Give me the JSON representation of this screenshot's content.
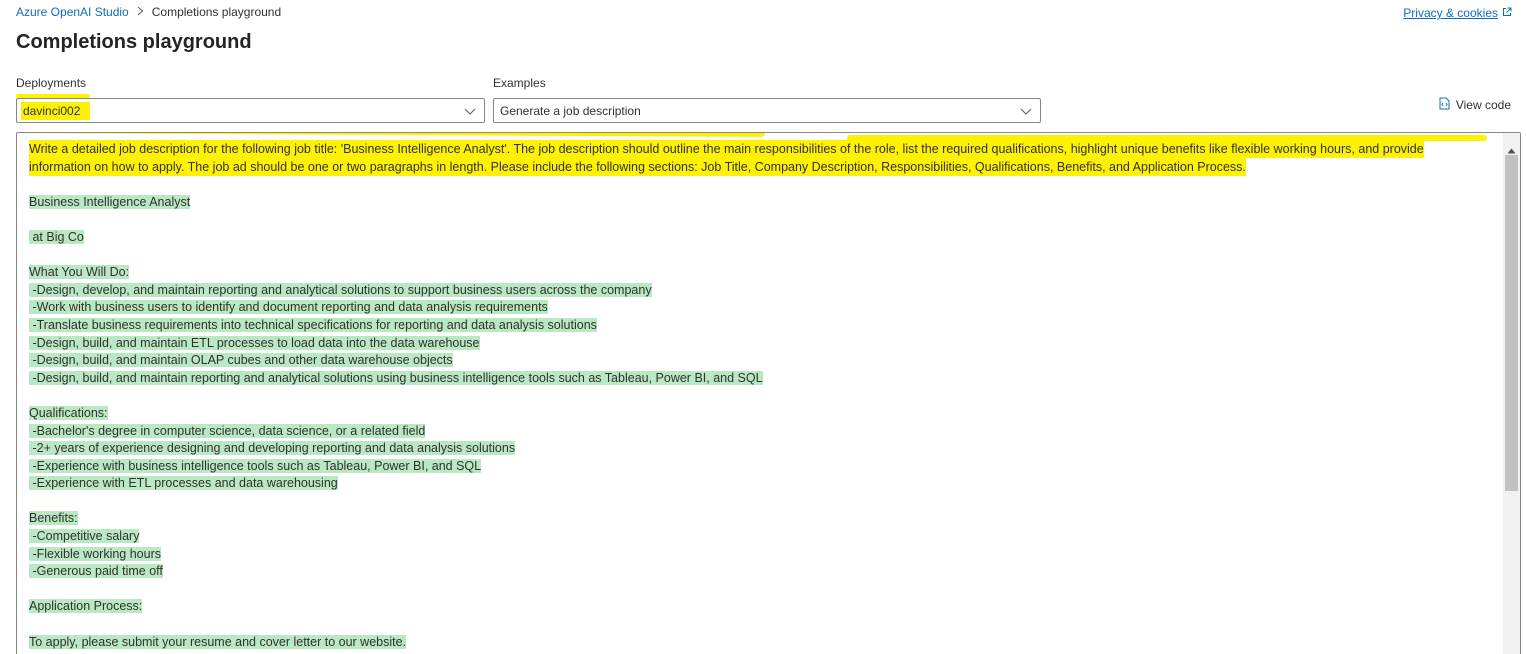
{
  "breadcrumb": {
    "root": "Azure OpenAI Studio",
    "current": "Completions playground"
  },
  "privacy_link": "Privacy & cookies",
  "page_title": "Completions playground",
  "deployments": {
    "label": "Deployments",
    "value": "davinci002"
  },
  "examples": {
    "label": "Examples",
    "value": "Generate a job description"
  },
  "view_code": "View code",
  "prompt": {
    "line1": "Write a detailed job description for the following job title: 'Business Intelligence Analyst'. The job description should outline the main responsibilities of the role, list the required qualifications, highlight unique benefits like flexible working hours, and provide",
    "line2": "information on how to apply. The job ad should be one or two paragraphs in length. Please include the following sections: Job Title, Company Description, Responsibilities, Qualifications, Benefits, and Application Process."
  },
  "response_lines": [
    "",
    "Business Intelligence Analyst",
    "",
    " at Big Co",
    "",
    "What You Will Do:",
    " -Design, develop, and maintain reporting and analytical solutions to support business users across the company",
    " -Work with business users to identify and document reporting and data analysis requirements",
    " -Translate business requirements into technical specifications for reporting and data analysis solutions",
    " -Design, build, and maintain ETL processes to load data into the data warehouse",
    " -Design, build, and maintain OLAP cubes and other data warehouse objects",
    " -Design, build, and maintain reporting and analytical solutions using business intelligence tools such as Tableau, Power BI, and SQL",
    "",
    "Qualifications:",
    " -Bachelor's degree in computer science, data science, or a related field",
    " -2+ years of experience designing and developing reporting and data analysis solutions",
    " -Experience with business intelligence tools such as Tableau, Power BI, and SQL",
    " -Experience with ETL processes and data warehousing",
    "",
    "Benefits:",
    " -Competitive salary",
    " -Flexible working hours",
    " -Generous paid time off",
    "",
    "Application Process:",
    "",
    "To apply, please submit your resume and cover letter to our website."
  ],
  "colors": {
    "link": "#0f6cbd",
    "prompt_highlight": "#fef200",
    "response_highlight": "#b9e8c3"
  },
  "icons": [
    "chevron-right-icon",
    "external-link-icon",
    "chevron-down-icon",
    "code-file-icon",
    "scroll-up-arrow-icon"
  ]
}
